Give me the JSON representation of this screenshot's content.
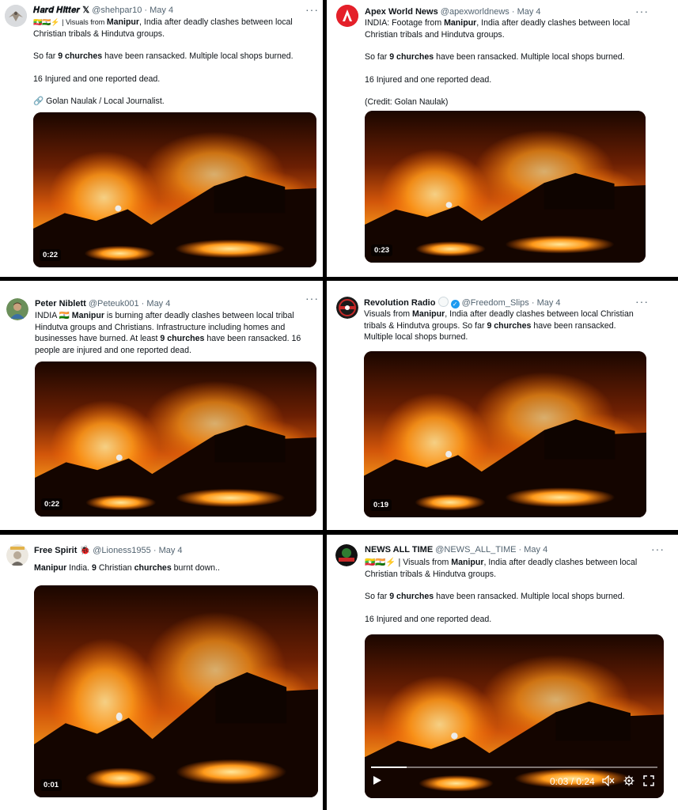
{
  "tweets": [
    {
      "name": "𝑯𝒂𝒓𝒅 𝑯𝒊𝒕𝒕𝒆𝒓 𝕏",
      "handle": "@shehpar10",
      "sep": " · ",
      "date": "May 4",
      "more": "···",
      "avatar_icon": "eagle-avatar-icon",
      "lines": [
        {
          "prefix": "🇲🇲🇮🇳⚡ | Visuals from ",
          "bold": "Manipur",
          "suffix": ", India after deadly clashes between local"
        },
        {
          "text": "Christian tribals & Hindutva groups."
        },
        {
          "gap": true
        },
        {
          "prefix": "So far ",
          "bold": "9 churches",
          "suffix": " have been ransacked. Multiple local shops burned."
        },
        {
          "gap": true
        },
        {
          "text": "16 Injured and one reported dead."
        },
        {
          "gap": true
        },
        {
          "text": "🔗 Golan Naulak / Local Journalist."
        }
      ],
      "duration": "0:22"
    },
    {
      "name": "Apex World News",
      "handle": "@apexworldnews",
      "sep": " · ",
      "date": "May 4",
      "more": "···",
      "avatar_icon": "apex-logo-icon",
      "lines": [
        {
          "prefix": "INDIA: Footage from ",
          "bold": "Manipur",
          "suffix": ", India after deadly clashes between local"
        },
        {
          "text": "Christian tribals and Hindutva groups."
        },
        {
          "gap": true
        },
        {
          "prefix": "So far ",
          "bold": "9 churches",
          "suffix": " have been ransacked. Multiple local shops burned."
        },
        {
          "gap": true
        },
        {
          "text": "16 Injured and one reported dead."
        },
        {
          "gap": true
        },
        {
          "text": "(Credit: Golan Naulak)"
        }
      ],
      "duration": "0:23"
    },
    {
      "name": "Peter Niblett",
      "handle": "@Peteuk001",
      "sep": " · ",
      "date": "May 4",
      "more": "···",
      "avatar_icon": "person-photo-avatar-icon",
      "lines": [
        {
          "prefix": "INDIA 🇮🇳 ",
          "bold": "Manipur",
          "suffix": " is burning after deadly clashes between local tribal"
        },
        {
          "text": "Hindutva groups and Christians. Infrastructure including homes and"
        },
        {
          "prefix": "businesses have burned. At least ",
          "bold": "9 churches",
          "suffix": " have been ransacked. 16"
        },
        {
          "text": "people are injured and one reported dead."
        }
      ],
      "duration": "0:22"
    },
    {
      "name": "Revolution Radio",
      "handle": "@Freedom_Slips",
      "sep": " · ",
      "date": "May 4",
      "more": "···",
      "avatar_icon": "revolution-logo-icon",
      "lines": [
        {
          "prefix": "Visuals from ",
          "bold": "Manipur",
          "suffix": ", India after deadly clashes between local Christian"
        },
        {
          "prefix": "tribals & Hindutva groups.  So far ",
          "bold": "9 churches",
          "suffix": " have been ransacked."
        },
        {
          "text": "Multiple local shops burned."
        }
      ],
      "duration": "0:19"
    },
    {
      "name": "Free Spirit 🐞",
      "handle": "@Lioness1955",
      "sep": " · ",
      "date": "May 4",
      "more": "",
      "avatar_icon": "portrait-avatar-icon",
      "lines": [
        {
          "bold": "Manipur",
          "mid": " India. ",
          "bold2": "9",
          "mid2": " Christian ",
          "bold3": "churches",
          "suffix": " burnt down.."
        }
      ],
      "duration": "0:01"
    },
    {
      "name": "NEWS ALL TIME",
      "handle": "@NEWS_ALL_TIME",
      "sep": " · ",
      "date": "May 4",
      "more": "···",
      "avatar_icon": "news-logo-icon",
      "lines": [
        {
          "prefix": "🇲🇲🇮🇳⚡ | Visuals from ",
          "bold": "Manipur",
          "suffix": ", India after deadly clashes between local"
        },
        {
          "text": "Christian tribals & Hindutva groups."
        },
        {
          "gap": true
        },
        {
          "prefix": "So far ",
          "bold": "9 churches",
          "suffix": " have been ransacked. Multiple local shops burned."
        },
        {
          "gap": true
        },
        {
          "text": "16 Injured and one reported dead."
        }
      ],
      "player": {
        "time": "0:03 / 0:24",
        "progress": 0.125
      }
    }
  ]
}
